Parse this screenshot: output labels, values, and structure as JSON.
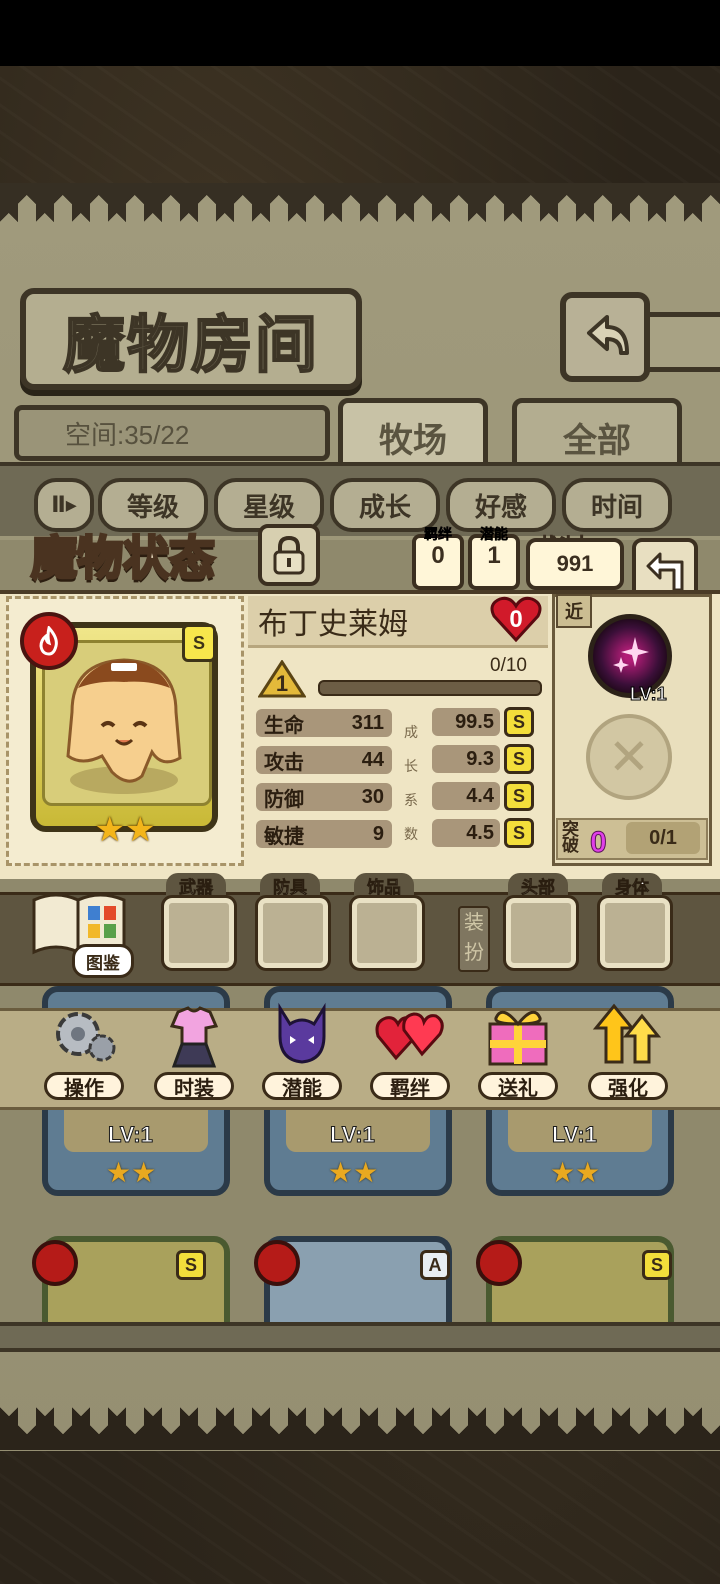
{
  "screen": {
    "title": "魔物房间",
    "space_label": "空间:35/22",
    "tabs": [
      "牧场",
      "全部"
    ],
    "sort_buttons": [
      "等级",
      "星级",
      "成长",
      "好感",
      "时间"
    ],
    "sort_toggle_glyph": "Ⅱ▸"
  },
  "status": {
    "title": "魔物状态",
    "bond_label": "羁绊",
    "bond_value": "0",
    "potential_label": "潜能",
    "potential_value": "1",
    "power_label": "战斗力",
    "power_value": "991"
  },
  "monster": {
    "name": "布丁史莱姆",
    "rank": "S",
    "affection": "0",
    "level": "1",
    "xp_text": "0/10",
    "xp_fraction": 0,
    "stars": 2,
    "stats": [
      {
        "label": "生命",
        "value": "311",
        "growth": "99.5",
        "grade": "S"
      },
      {
        "label": "攻击",
        "value": "44",
        "growth": "9.3",
        "grade": "S"
      },
      {
        "label": "防御",
        "value": "30",
        "growth": "4.4",
        "grade": "S"
      },
      {
        "label": "敏捷",
        "value": "9",
        "growth": "4.5",
        "grade": "S"
      }
    ],
    "growth_chars": [
      "成",
      "长",
      "系",
      "数"
    ]
  },
  "skill": {
    "range_tag": "近",
    "level_text": "LV:1"
  },
  "breakthrough": {
    "label": "突破",
    "count": "0",
    "progress": "0/1"
  },
  "equipment": {
    "codex_label": "图鉴",
    "dress_label": "装扮",
    "slots": [
      "武器",
      "防具",
      "饰品",
      "头部",
      "身体"
    ]
  },
  "actions": [
    "操作",
    "时装",
    "潜能",
    "羁绊",
    "送礼",
    "强化"
  ],
  "list_cards": [
    {
      "level": "LV:1"
    },
    {
      "level": "LV:1"
    },
    {
      "level": "LV:1"
    }
  ],
  "list_ranks_bottom": [
    "S",
    "A",
    "S"
  ],
  "colors": {
    "parchment": "#a09a7c",
    "panel": "#efe5c4",
    "dark_border": "#3d3526",
    "grade_yellow": "#f3de3b",
    "affection_red": "#d11a2a"
  }
}
